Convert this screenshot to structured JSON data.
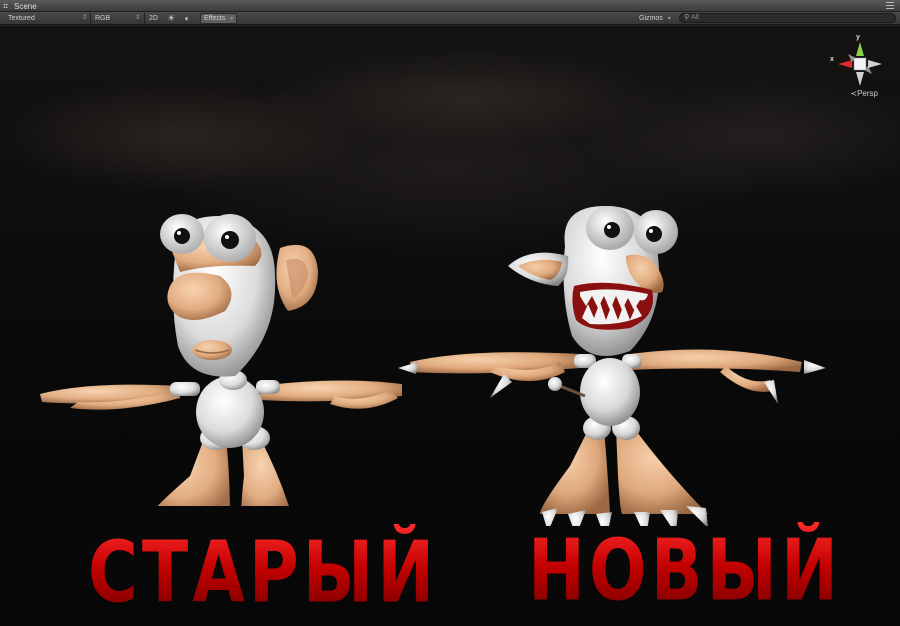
{
  "window": {
    "tab_title": "Scene"
  },
  "toolbar": {
    "render_mode": "Textured",
    "channel": "RGB",
    "mode_2d": "2D",
    "effects_label": "Effects",
    "gizmos_label": "Gizmos",
    "search_placeholder": "All"
  },
  "gizmo": {
    "y_axis": "y",
    "x_axis": "x",
    "projection": "Persp"
  },
  "captions": {
    "old": "СТАРЫЙ",
    "new": "НОВЫЙ"
  },
  "icons": {
    "tab": "grid-icon",
    "light": "sun-icon",
    "audio": "speaker-icon",
    "search": "search-icon",
    "menu": "menu-icon"
  },
  "colors": {
    "caption_red": "#d40000",
    "skin": "#e6b48a",
    "body_white": "#e8e8e8"
  }
}
